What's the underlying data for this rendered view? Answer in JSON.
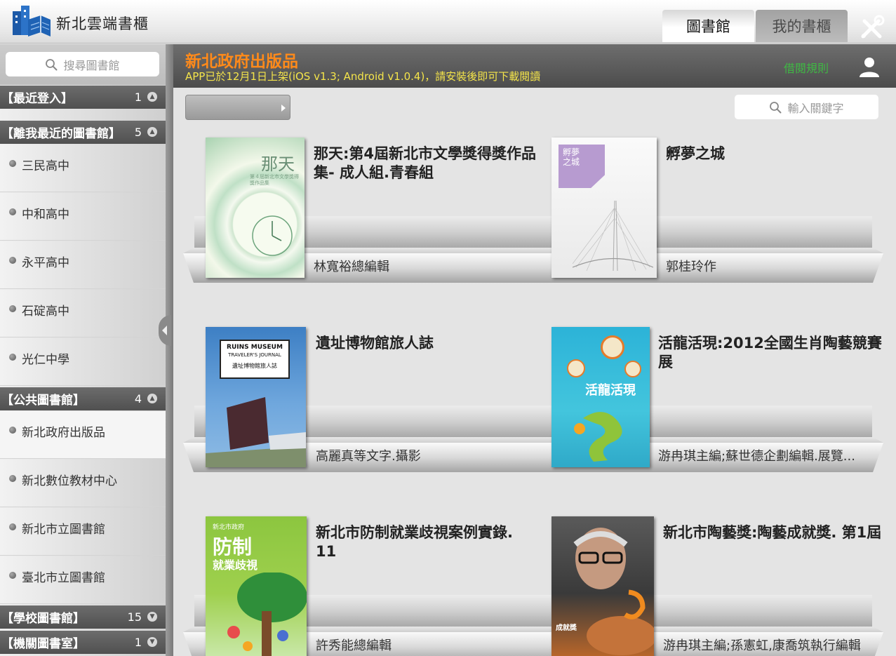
{
  "app": {
    "title": "新北雲端書櫃",
    "tabs": [
      {
        "label": "圖書館",
        "active": true
      },
      {
        "label": "我的書櫃",
        "active": false
      }
    ]
  },
  "sidebar": {
    "search_placeholder": "搜尋圖書館",
    "sections": [
      {
        "title": "【最近登入】",
        "count": "1",
        "expanded": true
      },
      {
        "title": "【離我最近的圖書館】",
        "count": "5",
        "expanded": true,
        "items": [
          "三民高中",
          "中和高中",
          "永平高中",
          "石碇高中",
          "光仁中學"
        ]
      },
      {
        "title": "【公共圖書館】",
        "count": "4",
        "expanded": true,
        "items": [
          "新北政府出版品",
          "新北數位教材中心",
          "新北市立圖書館",
          "臺北市立圖書館"
        ]
      },
      {
        "title": "【學校圖書館】",
        "count": "15",
        "expanded": false
      },
      {
        "title": "【機關圖書室】",
        "count": "1",
        "expanded": false
      }
    ],
    "selected_item": "新北政府出版品"
  },
  "main": {
    "library_title": "新北政府出版品",
    "notice": "APP已於12月1日上架(iOS v1.3; Android v1.0.4)，請安裝後即可下載閱讀",
    "borrow_rules": "借閱規則",
    "keyword_placeholder": "輸入關鍵字",
    "books": [
      {
        "title": "那天:第4屆新北市文學獎得獎作品集- 成人組.青春組",
        "author": "林寬裕總編輯",
        "cover": {
          "text": "那天",
          "subtext": "第４屆新北市文學獎得獎作品集"
        }
      },
      {
        "title": "孵夢之城",
        "author": "郭桂玲作",
        "cover": {
          "text": "孵夢之城"
        }
      },
      {
        "title": "遺址博物館旅人誌",
        "author": "高麗真等文字.攝影",
        "cover": {
          "text": "RUINS MUSEUM",
          "subtext": "TRAVELER'S JOURNAL",
          "subtext2": "遺址博物館旅人誌"
        }
      },
      {
        "title": "活龍活現:2012全國生肖陶藝競賽展",
        "author": "游冉琪主編;蘇世德企劃編輯.展覽...",
        "cover": {
          "text": "活龍活現"
        }
      },
      {
        "title": "新北市防制就業歧視案例實錄. 11",
        "author": "許秀能總編輯",
        "cover": {
          "text": "防制",
          "subtext": "就業歧視",
          "top": "新北市政府"
        }
      },
      {
        "title": "新北市陶藝獎:陶藝成就獎. 第1屆",
        "author": "游冉琪主編;孫憲虹,康喬筑執行編輯",
        "cover": {
          "text": "成就獎"
        }
      }
    ]
  },
  "colors": {
    "library_title": "#ff8a1a",
    "notice": "#f4e44a",
    "borrow_rules": "#3fb844",
    "section_header": "#5a5a5a"
  }
}
